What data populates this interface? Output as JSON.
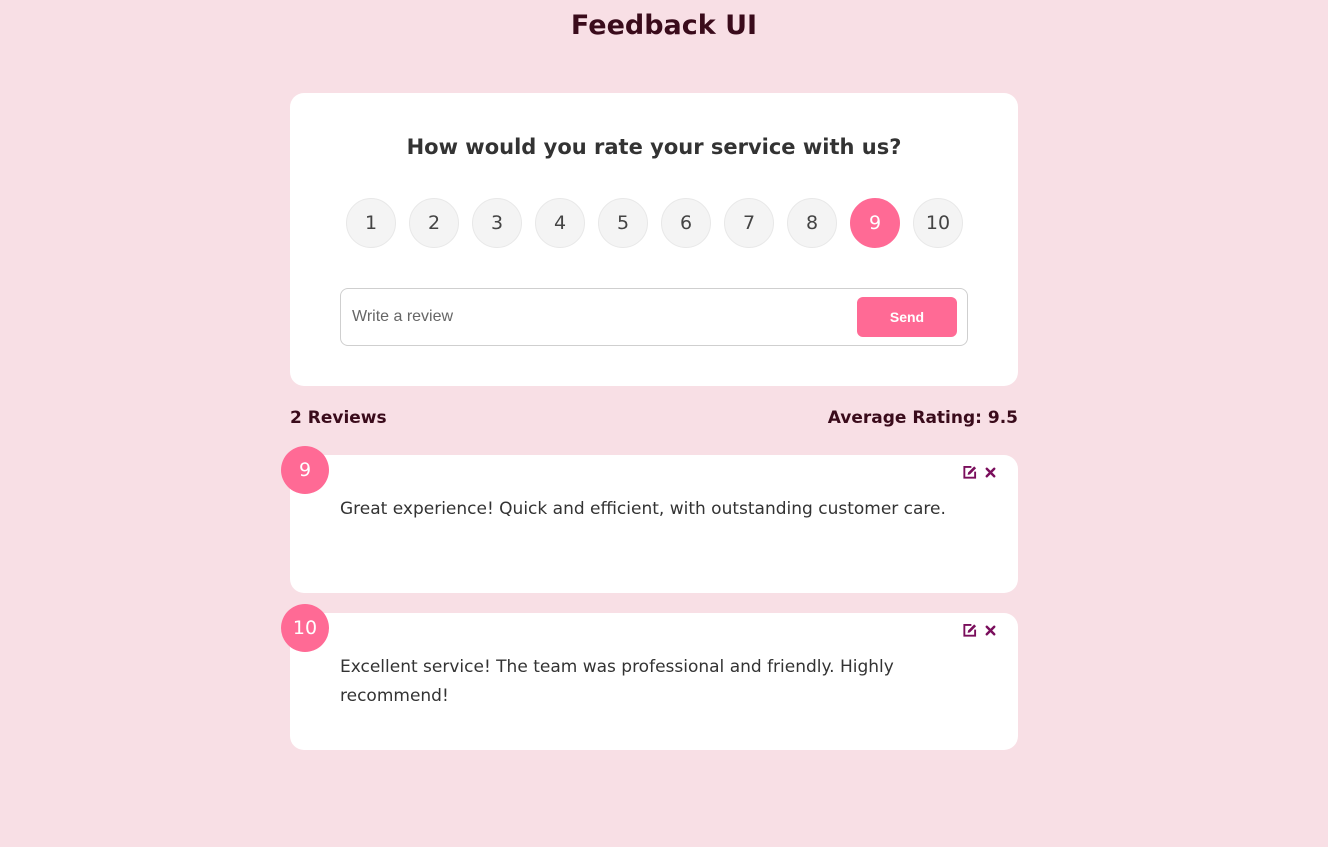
{
  "header": {
    "title": "Feedback UI"
  },
  "rating_card": {
    "question": "How would you rate your service with us?",
    "options": [
      "1",
      "2",
      "3",
      "4",
      "5",
      "6",
      "7",
      "8",
      "9",
      "10"
    ],
    "selected": "9",
    "review_placeholder": "Write a review",
    "review_value": "",
    "send_label": "Send"
  },
  "stats": {
    "review_count": "2 Reviews",
    "average_rating": "Average Rating: 9.5"
  },
  "reviews": [
    {
      "rating": "9",
      "text": "Great experience! Quick and efficient, with outstanding customer care."
    },
    {
      "rating": "10",
      "text": "Excellent service! The team was professional and friendly. Highly recommend!"
    }
  ],
  "icons": {
    "edit": "edit-icon",
    "delete": "close-icon"
  },
  "colors": {
    "background": "#f8dfe5",
    "accent": "#ff6a95",
    "heading": "#3a0b1b",
    "icon": "#7a0e5c"
  }
}
